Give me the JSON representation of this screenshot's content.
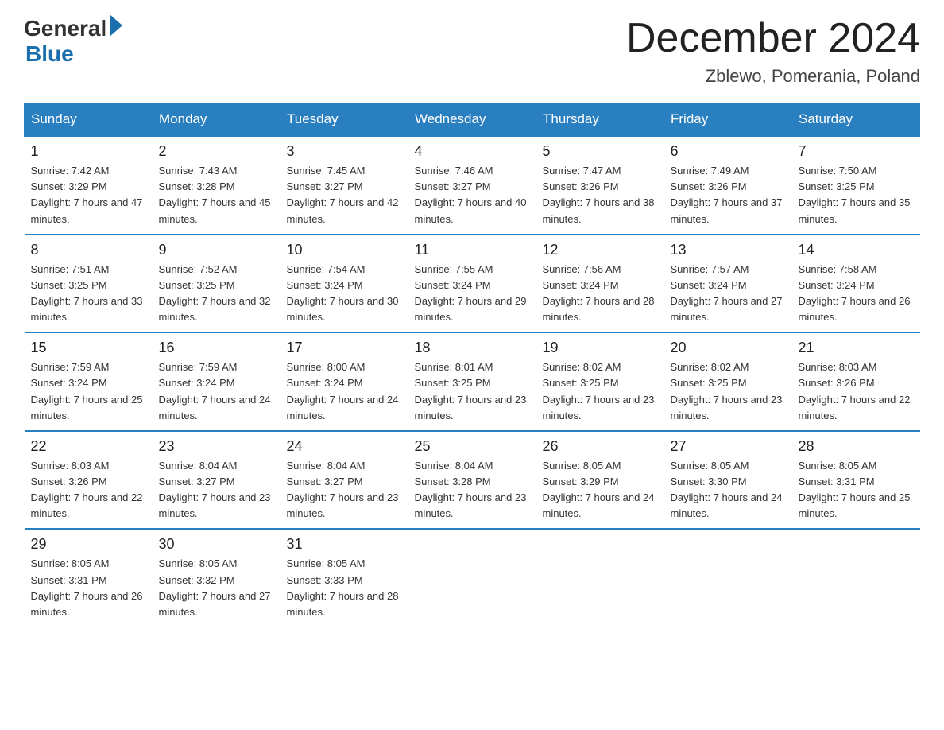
{
  "logo": {
    "general": "General",
    "blue": "Blue"
  },
  "title": "December 2024",
  "subtitle": "Zblewo, Pomerania, Poland",
  "days_of_week": [
    "Sunday",
    "Monday",
    "Tuesday",
    "Wednesday",
    "Thursday",
    "Friday",
    "Saturday"
  ],
  "weeks": [
    [
      {
        "num": "1",
        "sunrise": "7:42 AM",
        "sunset": "3:29 PM",
        "daylight": "7 hours and 47 minutes."
      },
      {
        "num": "2",
        "sunrise": "7:43 AM",
        "sunset": "3:28 PM",
        "daylight": "7 hours and 45 minutes."
      },
      {
        "num": "3",
        "sunrise": "7:45 AM",
        "sunset": "3:27 PM",
        "daylight": "7 hours and 42 minutes."
      },
      {
        "num": "4",
        "sunrise": "7:46 AM",
        "sunset": "3:27 PM",
        "daylight": "7 hours and 40 minutes."
      },
      {
        "num": "5",
        "sunrise": "7:47 AM",
        "sunset": "3:26 PM",
        "daylight": "7 hours and 38 minutes."
      },
      {
        "num": "6",
        "sunrise": "7:49 AM",
        "sunset": "3:26 PM",
        "daylight": "7 hours and 37 minutes."
      },
      {
        "num": "7",
        "sunrise": "7:50 AM",
        "sunset": "3:25 PM",
        "daylight": "7 hours and 35 minutes."
      }
    ],
    [
      {
        "num": "8",
        "sunrise": "7:51 AM",
        "sunset": "3:25 PM",
        "daylight": "7 hours and 33 minutes."
      },
      {
        "num": "9",
        "sunrise": "7:52 AM",
        "sunset": "3:25 PM",
        "daylight": "7 hours and 32 minutes."
      },
      {
        "num": "10",
        "sunrise": "7:54 AM",
        "sunset": "3:24 PM",
        "daylight": "7 hours and 30 minutes."
      },
      {
        "num": "11",
        "sunrise": "7:55 AM",
        "sunset": "3:24 PM",
        "daylight": "7 hours and 29 minutes."
      },
      {
        "num": "12",
        "sunrise": "7:56 AM",
        "sunset": "3:24 PM",
        "daylight": "7 hours and 28 minutes."
      },
      {
        "num": "13",
        "sunrise": "7:57 AM",
        "sunset": "3:24 PM",
        "daylight": "7 hours and 27 minutes."
      },
      {
        "num": "14",
        "sunrise": "7:58 AM",
        "sunset": "3:24 PM",
        "daylight": "7 hours and 26 minutes."
      }
    ],
    [
      {
        "num": "15",
        "sunrise": "7:59 AM",
        "sunset": "3:24 PM",
        "daylight": "7 hours and 25 minutes."
      },
      {
        "num": "16",
        "sunrise": "7:59 AM",
        "sunset": "3:24 PM",
        "daylight": "7 hours and 24 minutes."
      },
      {
        "num": "17",
        "sunrise": "8:00 AM",
        "sunset": "3:24 PM",
        "daylight": "7 hours and 24 minutes."
      },
      {
        "num": "18",
        "sunrise": "8:01 AM",
        "sunset": "3:25 PM",
        "daylight": "7 hours and 23 minutes."
      },
      {
        "num": "19",
        "sunrise": "8:02 AM",
        "sunset": "3:25 PM",
        "daylight": "7 hours and 23 minutes."
      },
      {
        "num": "20",
        "sunrise": "8:02 AM",
        "sunset": "3:25 PM",
        "daylight": "7 hours and 23 minutes."
      },
      {
        "num": "21",
        "sunrise": "8:03 AM",
        "sunset": "3:26 PM",
        "daylight": "7 hours and 22 minutes."
      }
    ],
    [
      {
        "num": "22",
        "sunrise": "8:03 AM",
        "sunset": "3:26 PM",
        "daylight": "7 hours and 22 minutes."
      },
      {
        "num": "23",
        "sunrise": "8:04 AM",
        "sunset": "3:27 PM",
        "daylight": "7 hours and 23 minutes."
      },
      {
        "num": "24",
        "sunrise": "8:04 AM",
        "sunset": "3:27 PM",
        "daylight": "7 hours and 23 minutes."
      },
      {
        "num": "25",
        "sunrise": "8:04 AM",
        "sunset": "3:28 PM",
        "daylight": "7 hours and 23 minutes."
      },
      {
        "num": "26",
        "sunrise": "8:05 AM",
        "sunset": "3:29 PM",
        "daylight": "7 hours and 24 minutes."
      },
      {
        "num": "27",
        "sunrise": "8:05 AM",
        "sunset": "3:30 PM",
        "daylight": "7 hours and 24 minutes."
      },
      {
        "num": "28",
        "sunrise": "8:05 AM",
        "sunset": "3:31 PM",
        "daylight": "7 hours and 25 minutes."
      }
    ],
    [
      {
        "num": "29",
        "sunrise": "8:05 AM",
        "sunset": "3:31 PM",
        "daylight": "7 hours and 26 minutes."
      },
      {
        "num": "30",
        "sunrise": "8:05 AM",
        "sunset": "3:32 PM",
        "daylight": "7 hours and 27 minutes."
      },
      {
        "num": "31",
        "sunrise": "8:05 AM",
        "sunset": "3:33 PM",
        "daylight": "7 hours and 28 minutes."
      },
      null,
      null,
      null,
      null
    ]
  ]
}
